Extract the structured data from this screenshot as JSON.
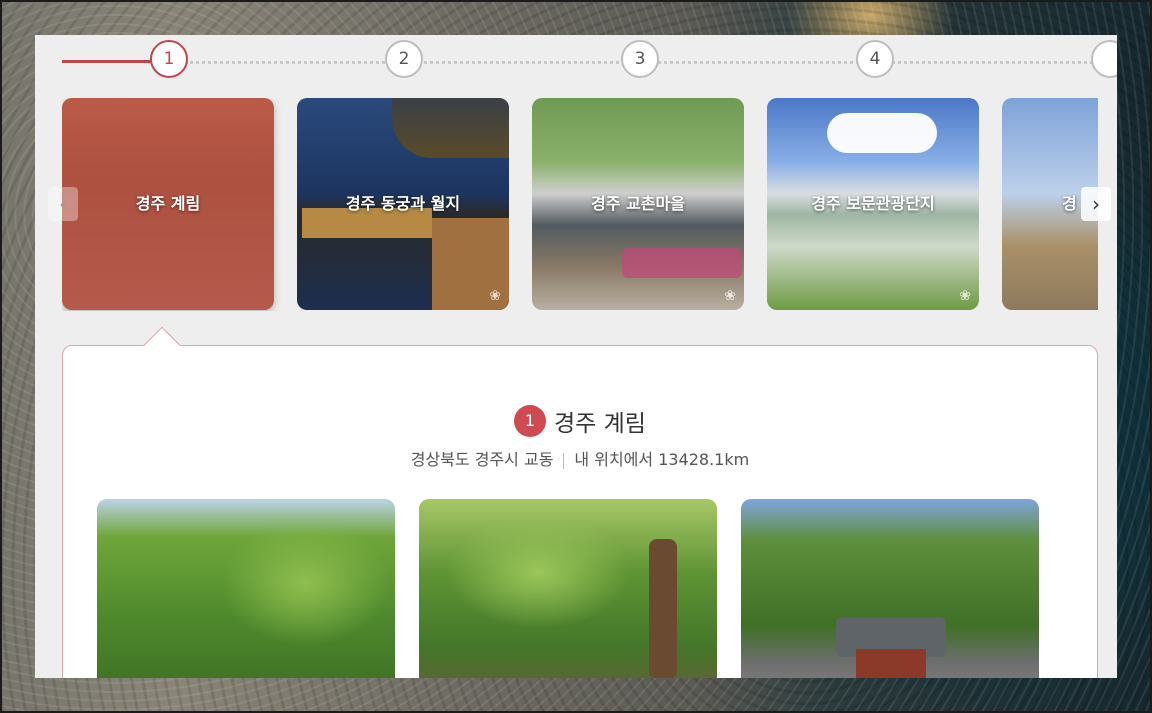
{
  "steps": [
    "1",
    "2",
    "3",
    "4"
  ],
  "carousel": {
    "items": [
      {
        "label": "경주 계림",
        "active": true
      },
      {
        "label": "경주 동궁과 월지",
        "active": false
      },
      {
        "label": "경주 교촌마을",
        "active": false
      },
      {
        "label": "경주 보문관광단지",
        "active": false
      },
      {
        "label": "경",
        "active": false
      }
    ],
    "prev_icon": "chevron-left-icon",
    "next_icon": "chevron-right-icon"
  },
  "detail": {
    "number": "1",
    "title": "경주 계림",
    "address": "경상북도 경주시 교동",
    "distance": "내 위치에서 13428.1km"
  },
  "colors": {
    "accent": "#cf4b52",
    "panel_bg": "#efeeee"
  }
}
